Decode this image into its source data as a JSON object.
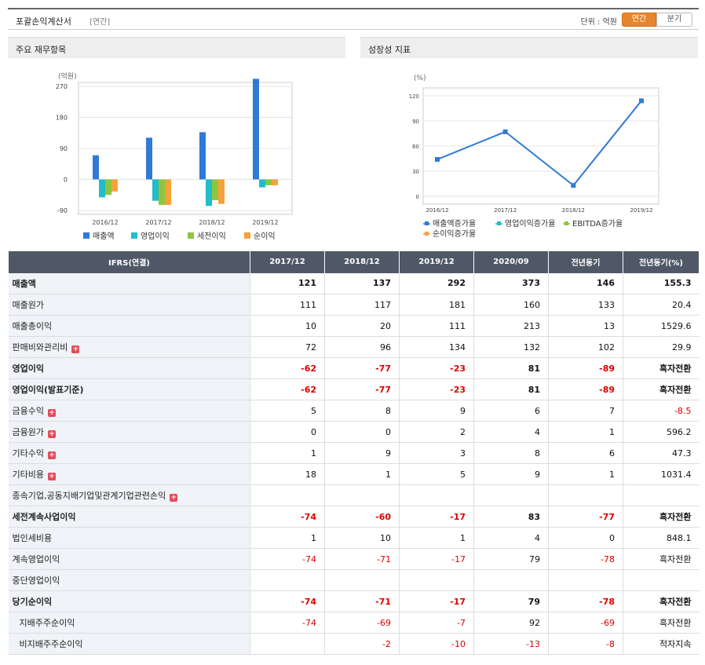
{
  "header": {
    "title": "포괄손익계산서",
    "subtitle": "[연간]",
    "unit": "단위 : 억원",
    "toggle_on": "연간",
    "toggle_off": "분기"
  },
  "panels": {
    "left_title": "주요 재무항목",
    "right_title": "성장성 지표"
  },
  "chart_data": [
    {
      "type": "bar",
      "unit_label": "(억원)",
      "categories": [
        "2016/12",
        "2017/12",
        "2018/12",
        "2019/12"
      ],
      "ylim": [
        -90,
        270
      ],
      "yticks": [
        270,
        180,
        90,
        0,
        -90
      ],
      "grid": true,
      "legend_position": "bottom",
      "series": [
        {
          "name": "매출액",
          "color": "#2e7ad6",
          "values": [
            70,
            121,
            137,
            292
          ]
        },
        {
          "name": "영업이익",
          "color": "#23bccb",
          "values": [
            -52,
            -62,
            -77,
            -23
          ]
        },
        {
          "name": "세전이익",
          "color": "#8cc63f",
          "values": [
            -45,
            -74,
            -60,
            -17
          ]
        },
        {
          "name": "순이익",
          "color": "#f5a23a",
          "values": [
            -35,
            -74,
            -71,
            -17
          ]
        }
      ]
    },
    {
      "type": "line",
      "unit_label": "(%)",
      "categories": [
        "2016/12",
        "2017/12",
        "2018/12",
        "2019/12"
      ],
      "ylim": [
        0,
        120
      ],
      "yticks": [
        120,
        90,
        60,
        30,
        0
      ],
      "grid": true,
      "legend_position": "bottom",
      "series": [
        {
          "name": "매출액증가율",
          "color": "#2e7ad6",
          "values": [
            44,
            77,
            13,
            114
          ]
        }
      ],
      "legend": [
        {
          "name": "매출액증가율",
          "color": "#2e7ad6"
        },
        {
          "name": "영업이익증가율",
          "color": "#23bccb"
        },
        {
          "name": "EBITDA증가율",
          "color": "#8cc63f"
        },
        {
          "name": "순이익증가율",
          "color": "#f5a23a"
        }
      ]
    }
  ],
  "table": {
    "headers": [
      "IFRS(연결)",
      "2017/12",
      "2018/12",
      "2019/12",
      "2020/09",
      "전년동기",
      "전년동기(%)"
    ],
    "rows": [
      {
        "label": "매출액",
        "plus": false,
        "bold": true,
        "sep": false,
        "indent": false,
        "neg": false,
        "cells": [
          "121",
          "137",
          "292",
          "373",
          "146",
          "155.3"
        ]
      },
      {
        "label": "매출원가",
        "plus": false,
        "bold": false,
        "sep": false,
        "indent": false,
        "neg": false,
        "cells": [
          "111",
          "117",
          "181",
          "160",
          "133",
          "20.4"
        ]
      },
      {
        "label": "매출총이익",
        "plus": false,
        "bold": false,
        "sep": false,
        "indent": false,
        "neg": false,
        "cells": [
          "10",
          "20",
          "111",
          "213",
          "13",
          "1529.6"
        ]
      },
      {
        "label": "판매비와관리비",
        "plus": true,
        "bold": false,
        "sep": false,
        "indent": false,
        "neg": false,
        "cells": [
          "72",
          "96",
          "134",
          "132",
          "102",
          "29.9"
        ]
      },
      {
        "label": "영업이익",
        "plus": false,
        "bold": true,
        "sep": true,
        "indent": false,
        "neg": true,
        "cells": [
          "-62",
          "-77",
          "-23",
          "81",
          "-89",
          "흑자전환"
        ]
      },
      {
        "label": "영업이익(발표기준)",
        "plus": false,
        "bold": true,
        "sep": true,
        "indent": false,
        "neg": true,
        "cells": [
          "-62",
          "-77",
          "-23",
          "81",
          "-89",
          "흑자전환"
        ]
      },
      {
        "label": "금융수익",
        "plus": true,
        "bold": false,
        "sep": true,
        "indent": false,
        "neg": false,
        "cells": [
          "5",
          "8",
          "9",
          "6",
          "7",
          "-8.5"
        ]
      },
      {
        "label": "금융원가",
        "plus": true,
        "bold": false,
        "sep": false,
        "indent": false,
        "neg": false,
        "cells": [
          "0",
          "0",
          "2",
          "4",
          "1",
          "596.2"
        ]
      },
      {
        "label": "기타수익",
        "plus": true,
        "bold": false,
        "sep": false,
        "indent": false,
        "neg": false,
        "cells": [
          "1",
          "9",
          "3",
          "8",
          "6",
          "47.3"
        ]
      },
      {
        "label": "기타비용",
        "plus": true,
        "bold": false,
        "sep": false,
        "indent": false,
        "neg": false,
        "cells": [
          "18",
          "1",
          "5",
          "9",
          "1",
          "1031.4"
        ]
      },
      {
        "label": "종속기업,공동지배기업및관계기업관련손익",
        "plus": true,
        "bold": false,
        "sep": false,
        "indent": false,
        "neg": false,
        "cells": [
          "",
          "",
          "",
          "",
          "",
          ""
        ]
      },
      {
        "label": "세전계속사업이익",
        "plus": false,
        "bold": true,
        "sep": true,
        "indent": false,
        "neg": true,
        "cells": [
          "-74",
          "-60",
          "-17",
          "83",
          "-77",
          "흑자전환"
        ]
      },
      {
        "label": "법인세비용",
        "plus": false,
        "bold": false,
        "sep": true,
        "indent": false,
        "neg": false,
        "cells": [
          "1",
          "10",
          "1",
          "4",
          "0",
          "848.1"
        ]
      },
      {
        "label": "계속영업이익",
        "plus": false,
        "bold": false,
        "sep": false,
        "indent": false,
        "neg": true,
        "cells": [
          "-74",
          "-71",
          "-17",
          "79",
          "-78",
          "흑자전환"
        ]
      },
      {
        "label": "중단영업이익",
        "plus": false,
        "bold": false,
        "sep": false,
        "indent": false,
        "neg": false,
        "cells": [
          "",
          "",
          "",
          "",
          "",
          ""
        ]
      },
      {
        "label": "당기순이익",
        "plus": false,
        "bold": true,
        "sep": true,
        "indent": false,
        "neg": true,
        "cells": [
          "-74",
          "-71",
          "-17",
          "79",
          "-78",
          "흑자전환"
        ]
      },
      {
        "label": "지배주주순이익",
        "plus": false,
        "bold": false,
        "sep": false,
        "indent": true,
        "neg": true,
        "cells": [
          "-74",
          "-69",
          "-7",
          "92",
          "-69",
          "흑자전환"
        ]
      },
      {
        "label": "비지배주주순이익",
        "plus": false,
        "bold": false,
        "sep": false,
        "indent": true,
        "neg": true,
        "cells": [
          "",
          "-2",
          "-10",
          "-13",
          "-8",
          "적자지속"
        ]
      }
    ]
  }
}
